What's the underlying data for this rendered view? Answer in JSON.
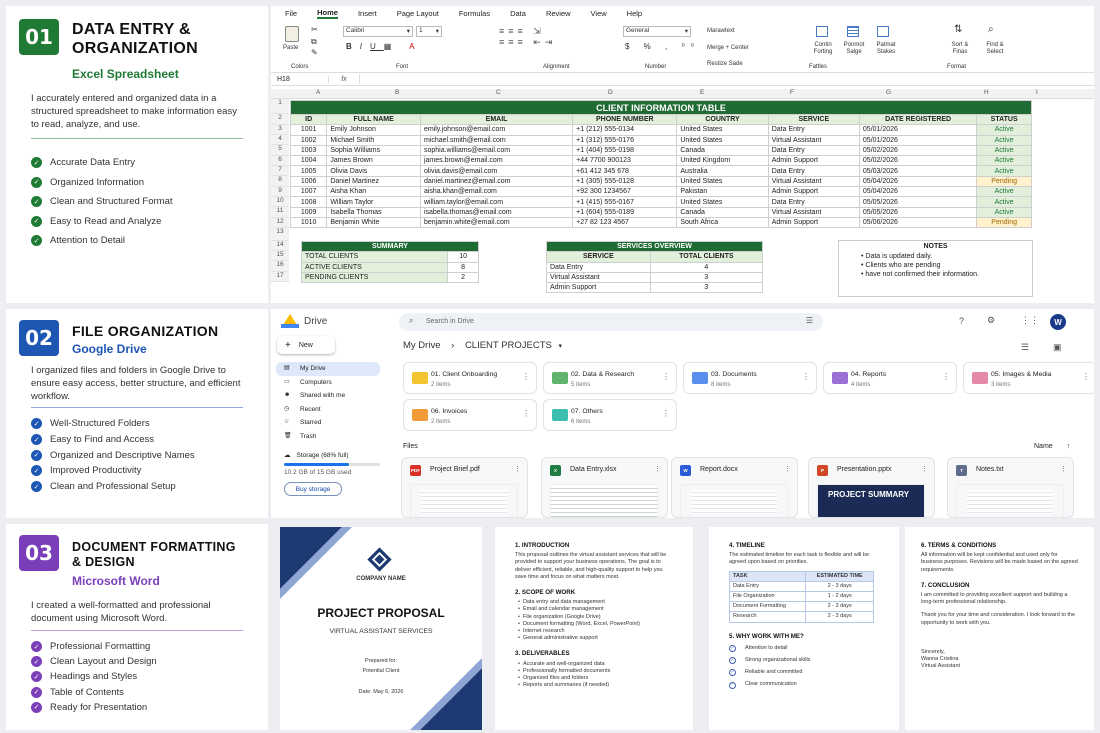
{
  "panels": [
    {
      "number": "01",
      "title1": "DATA ENTRY &",
      "title2": "ORGANIZATION",
      "subtitle": "Excel Spreadsheet",
      "description": "I accurately entered and organized data in a structured spreadsheet to make information easy to read, analyze, and use.",
      "features": [
        "Accurate Data Entry",
        "Organized Information",
        "Clean and Structured Format",
        "Easy to Read and Analyze",
        "Attention to Detail"
      ],
      "color": "#1f7a35"
    },
    {
      "number": "02",
      "title1": "FILE ORGANIZATION",
      "title2": "",
      "subtitle": "Google Drive",
      "description": "I organized files and folders in Google Drive to ensure easy access, better structure, and efficient workflow.",
      "features": [
        "Well-Structured Folders",
        "Easy to Find and Access",
        "Organized and Descriptive Names",
        "Improved Productivity",
        "Clean and Professional Setup"
      ],
      "color": "#1e56b3"
    },
    {
      "number": "03",
      "title1": "DOCUMENT FORMATTING",
      "title2": "& DESIGN",
      "subtitle": "Microsoft Word",
      "description": "I created a well-formatted and professional document using Microsoft Word.",
      "features": [
        "Professional Formatting",
        "Clean Layout and Design",
        "Headings and Styles",
        "Table of Contents",
        "Ready for Presentation"
      ],
      "color": "#7a3fb8"
    }
  ],
  "excel": {
    "menu": [
      "File",
      "Home",
      "Insert",
      "Page Layout",
      "Formulas",
      "Data",
      "Review",
      "View",
      "Help"
    ],
    "font": "Calibri",
    "size": "1",
    "format": "General",
    "ribbon": {
      "paste": "Paste",
      "clipboard": "Colors",
      "font_group": "Font",
      "alignment": "Alignment",
      "number": "Number",
      "wrap": "Marawtext",
      "merge": "Merge + Center",
      "merge2": "Restize Sade",
      "cond": "Contin Forting",
      "fmt_table": "Ponmot Salge",
      "styles": "Patmat Stakes",
      "insert": "Sort & Finas",
      "find": "Find & Select",
      "group1": "Fattles",
      "group2": "Format"
    },
    "cell_ref": "H18",
    "fx": "fx",
    "cols": [
      "A",
      "B",
      "C",
      "D",
      "E",
      "F",
      "G",
      "H",
      "I"
    ],
    "table_title": "CLIENT INFORMATION TABLE",
    "headers": [
      "ID",
      "FULL NAME",
      "EMAIL",
      "PHONE NUMBER",
      "COUNTRY",
      "SERVICE",
      "DATE REGISTERED",
      "STATUS"
    ],
    "rows": [
      [
        "1001",
        "Emily Johnson",
        "emily.johnson@email.com",
        "+1 (212) 555-0134",
        "United States",
        "Data Entry",
        "05/01/2026",
        "Active"
      ],
      [
        "1002",
        "Michael Smith",
        "michael.smith@email.com",
        "+1 (312) 555-0176",
        "United States",
        "Virtual Assistant",
        "05/01/2026",
        "Active"
      ],
      [
        "1003",
        "Sophia Williams",
        "sophia.williams@email.com",
        "+1 (404) 555-0198",
        "Canada",
        "Data Entry",
        "05/02/2026",
        "Active"
      ],
      [
        "1004",
        "James Brown",
        "james.brown@email.com",
        "+44 7700 900123",
        "United Kingdom",
        "Admin Support",
        "05/02/2026",
        "Active"
      ],
      [
        "1005",
        "Olivia Davis",
        "olivia.davis@email.com",
        "+61 412 345 678",
        "Australia",
        "Data Entry",
        "05/03/2026",
        "Active"
      ],
      [
        "1006",
        "Daniel Martinez",
        "daniel.martinez@email.com",
        "+1 (305) 555-0128",
        "United States",
        "Virtual Assistant",
        "05/04/2026",
        "Pending"
      ],
      [
        "1007",
        "Aisha Khan",
        "aisha.khan@email.com",
        "+92 300 1234567",
        "Pakistan",
        "Admin Support",
        "05/04/2026",
        "Active"
      ],
      [
        "1008",
        "William Taylor",
        "william.taylor@email.com",
        "+1 (415) 555-0167",
        "United States",
        "Data Entry",
        "05/05/2026",
        "Active"
      ],
      [
        "1009",
        "Isabella Thomas",
        "isabella.thomas@email.com",
        "+1 (604) 555-0189",
        "Canada",
        "Virtual Assistant",
        "05/05/2026",
        "Active"
      ],
      [
        "1010",
        "Benjamin White",
        "benjamin.white@email.com",
        "+27 82 123 4567",
        "South Africa",
        "Admin Support",
        "05/06/2026",
        "Pending"
      ]
    ],
    "summary_title": "SUMMARY",
    "summary": [
      [
        "TOTAL CLIENTS",
        "10"
      ],
      [
        "ACTIVE CLIENTS",
        "8"
      ],
      [
        "PENDING CLIENTS",
        "2"
      ]
    ],
    "services_title": "SERVICES OVERVIEW",
    "services_headers": [
      "SERVICE",
      "TOTAL CLIENTS"
    ],
    "services": [
      [
        "Data Entry",
        "4"
      ],
      [
        "Virtual Assistant",
        "3"
      ],
      [
        "Admin Support",
        "3"
      ]
    ],
    "notes_title": "NOTES",
    "notes": [
      "Data is updated daily.",
      "Clients who are pending",
      "have not confirmed their information."
    ],
    "row_numbers": [
      "1",
      "2",
      "3",
      "4",
      "5",
      "6",
      "7",
      "8",
      "9",
      "10",
      "11",
      "12",
      "13",
      "14",
      "15",
      "16",
      "17"
    ]
  },
  "drive": {
    "logo": "Drive",
    "search_placeholder": "Search in Drive",
    "new": "New",
    "avatar": "W",
    "nav": [
      "My Drive",
      "Computers",
      "Shared with me",
      "Recent",
      "Starred",
      "Trash"
    ],
    "storage": "Storage (68% full)",
    "storage_detail": "10.2 GB of 15 GB used",
    "storage_fraction": 0.68,
    "buy": "Buy storage",
    "breadcrumb1": "My Drive",
    "breadcrumb2": "CLIENT PROJECTS",
    "folders": [
      {
        "name": "01. Client Onboarding",
        "count": "2 items",
        "color": "#f4c430"
      },
      {
        "name": "02. Data & Research",
        "count": "5 items",
        "color": "#5fb36b"
      },
      {
        "name": "03. Documents",
        "count": "8 items",
        "color": "#5b8def"
      },
      {
        "name": "04. Reports",
        "count": "4 items",
        "color": "#9a6fd6"
      },
      {
        "name": "05. Images & Media",
        "count": "3 items",
        "color": "#e58aa6"
      },
      {
        "name": "06. Invoices",
        "count": "2 items",
        "color": "#f39a3a"
      },
      {
        "name": "07. Others",
        "count": "6 items",
        "color": "#3bbfb0"
      }
    ],
    "files_label": "Files",
    "sort": "Name",
    "files": [
      {
        "name": "Project Brief.pdf",
        "icon": "PDF",
        "color": "#d93025"
      },
      {
        "name": "Data Entry.xlsx",
        "icon": "X",
        "color": "#1e7d45"
      },
      {
        "name": "Report.docx",
        "icon": "W",
        "color": "#2a5bd7"
      },
      {
        "name": "Presentation.pptx",
        "icon": "P",
        "color": "#d24726"
      },
      {
        "name": "Notes.txt",
        "icon": "T",
        "color": "#5f6d8c"
      }
    ],
    "pptx_thumb": "PROJECT SUMMARY"
  },
  "word": {
    "company": "COMPANY NAME",
    "title": "PROJECT PROPOSAL",
    "subtitle": "VIRTUAL ASSISTANT SERVICES",
    "prepared": "Prepared for:",
    "client": "Potential Client",
    "date": "Date: May 6, 2026",
    "p2": {
      "h1": "1. INTRODUCTION",
      "intro": "This proposal outlines the virtual assistant services that will be provided to support your business operations. The goal is to deliver efficient, reliable, and high-quality support to help you save time and focus on what matters most.",
      "h2": "2. SCOPE OF WORK",
      "scope": [
        "Data entry and data management",
        "Email and calendar management",
        "File organization (Google Drive)",
        "Document formatting (Word, Excel, PowerPoint)",
        "Internet research",
        "General administrative support"
      ],
      "h3": "3. DELIVERABLES",
      "deliv": [
        "Accurate and well-organized data",
        "Professionally formatted documents",
        "Organized files and folders",
        "Reports and summaries (if needed)"
      ]
    },
    "p3": {
      "h1": "4. TIMELINE",
      "text": "The estimated timeline for each task is flexible and will be agreed upon based on priorities.",
      "th": [
        "TASK",
        "ESTIMATED TIME"
      ],
      "rows": [
        [
          "Data Entry",
          "2 - 3 days"
        ],
        [
          "File Organization",
          "1 - 2 days"
        ],
        [
          "Document Formatting",
          "2 - 3 days"
        ],
        [
          "Research",
          "2 - 3 days"
        ]
      ],
      "h2": "5. WHY WORK WITH ME?",
      "why": [
        "Attention to detail",
        "Strong organizational skills",
        "Reliable and committed",
        "Clear communication"
      ]
    },
    "p4": {
      "h1": "6. TERMS & CONDITIONS",
      "terms": "All information will be kept confidential and used only for business purposes. Revisions will be made based on the agreed requirements.",
      "h2": "7. CONCLUSION",
      "conc": "I am committed to providing excellent support and building a long-term professional relationship.",
      "thanks": "Thank you for your time and consideration. I look forward to the opportunity to work with you.",
      "sincerely": "Sincerely,",
      "name": "Wanna Cristina",
      "role": "Virtual Assistant"
    }
  }
}
